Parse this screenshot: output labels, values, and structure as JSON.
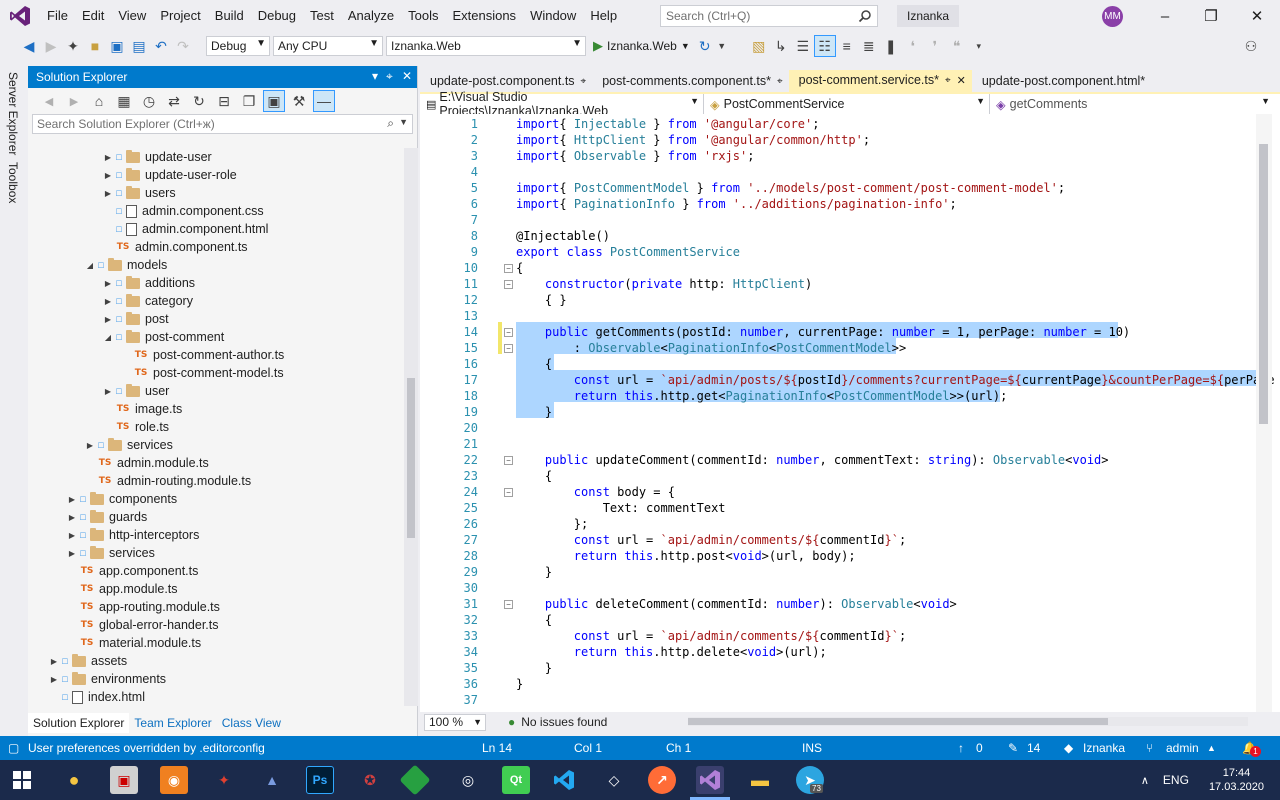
{
  "menu": [
    "File",
    "Edit",
    "View",
    "Project",
    "Build",
    "Debug",
    "Test",
    "Analyze",
    "Tools",
    "Extensions",
    "Window",
    "Help"
  ],
  "search": {
    "placeholder": "Search (Ctrl+Q)"
  },
  "solution_name": "Iznanka",
  "avatar_initials": "MM",
  "toolbar": {
    "config": "Debug",
    "platform": "Any CPU",
    "startup_project": "Iznanka.Web",
    "run_label": "Iznanka.Web"
  },
  "rail": {
    "server_explorer": "Server Explorer",
    "toolbox": "Toolbox"
  },
  "solution_explorer": {
    "title": "Solution Explorer",
    "search_placeholder": "Search Solution Explorer (Ctrl+ж)",
    "tree": [
      {
        "label": "update-user",
        "kind": "folder",
        "depth": 6,
        "expander": "collapsed"
      },
      {
        "label": "update-user-role",
        "kind": "folder",
        "depth": 6,
        "expander": "collapsed"
      },
      {
        "label": "users",
        "kind": "folder",
        "depth": 6,
        "expander": "collapsed"
      },
      {
        "label": "admin.component.css",
        "kind": "file",
        "depth": 6,
        "expander": "none"
      },
      {
        "label": "admin.component.html",
        "kind": "file",
        "depth": 6,
        "expander": "none"
      },
      {
        "label": "admin.component.ts",
        "kind": "ts",
        "depth": 6,
        "expander": "none"
      },
      {
        "label": "models",
        "kind": "folder",
        "depth": 5,
        "expander": "expanded"
      },
      {
        "label": "additions",
        "kind": "folder",
        "depth": 6,
        "expander": "collapsed"
      },
      {
        "label": "category",
        "kind": "folder",
        "depth": 6,
        "expander": "collapsed"
      },
      {
        "label": "post",
        "kind": "folder",
        "depth": 6,
        "expander": "collapsed"
      },
      {
        "label": "post-comment",
        "kind": "folder",
        "depth": 6,
        "expander": "expanded"
      },
      {
        "label": "post-comment-author.ts",
        "kind": "ts",
        "depth": 7,
        "expander": "none"
      },
      {
        "label": "post-comment-model.ts",
        "kind": "ts",
        "depth": 7,
        "expander": "none"
      },
      {
        "label": "user",
        "kind": "folder",
        "depth": 6,
        "expander": "collapsed"
      },
      {
        "label": "image.ts",
        "kind": "ts",
        "depth": 6,
        "expander": "none"
      },
      {
        "label": "role.ts",
        "kind": "ts",
        "depth": 6,
        "expander": "none"
      },
      {
        "label": "services",
        "kind": "folder",
        "depth": 5,
        "expander": "collapsed"
      },
      {
        "label": "admin.module.ts",
        "kind": "ts",
        "depth": 5,
        "expander": "none"
      },
      {
        "label": "admin-routing.module.ts",
        "kind": "ts",
        "depth": 5,
        "expander": "none"
      },
      {
        "label": "components",
        "kind": "folder",
        "depth": 4,
        "expander": "collapsed"
      },
      {
        "label": "guards",
        "kind": "folder",
        "depth": 4,
        "expander": "collapsed"
      },
      {
        "label": "http-interceptors",
        "kind": "folder",
        "depth": 4,
        "expander": "collapsed"
      },
      {
        "label": "services",
        "kind": "folder",
        "depth": 4,
        "expander": "collapsed"
      },
      {
        "label": "app.component.ts",
        "kind": "ts",
        "depth": 4,
        "expander": "none"
      },
      {
        "label": "app.module.ts",
        "kind": "ts",
        "depth": 4,
        "expander": "none"
      },
      {
        "label": "app-routing.module.ts",
        "kind": "ts",
        "depth": 4,
        "expander": "none"
      },
      {
        "label": "global-error-hander.ts",
        "kind": "ts",
        "depth": 4,
        "expander": "none"
      },
      {
        "label": "material.module.ts",
        "kind": "ts",
        "depth": 4,
        "expander": "none"
      },
      {
        "label": "assets",
        "kind": "folder",
        "depth": 3,
        "expander": "collapsed"
      },
      {
        "label": "environments",
        "kind": "folder",
        "depth": 3,
        "expander": "collapsed"
      },
      {
        "label": "index.html",
        "kind": "file",
        "depth": 3,
        "expander": "none"
      }
    ],
    "bottom_tabs": [
      "Solution Explorer",
      "Team Explorer",
      "Class View"
    ]
  },
  "editor": {
    "tabs": [
      {
        "label": "update-post.component.ts",
        "active": false
      },
      {
        "label": "post-comments.component.ts*",
        "active": false
      },
      {
        "label": "post-comment.service.ts*",
        "active": true
      },
      {
        "label": "update-post.component.html*",
        "active": false
      }
    ],
    "nav": {
      "path": "E:\\Visual Studio Projects\\Iznanka\\Iznanka.Web",
      "class": "PostCommentService",
      "member": "getComments"
    },
    "zoom": "100 %",
    "issues": "No issues found",
    "lines": [
      [
        [
          "kw",
          "import"
        ],
        [
          "",
          "{ "
        ],
        [
          "ty",
          "Injectable"
        ],
        [
          "",
          " } "
        ],
        [
          "kw",
          "from"
        ],
        [
          "",
          ""
        ],
        [
          "str",
          " '@angular/core'"
        ],
        [
          "",
          ";"
        ]
      ],
      [
        [
          "kw",
          "import"
        ],
        [
          "",
          "{ "
        ],
        [
          "ty",
          "HttpClient"
        ],
        [
          "",
          " } "
        ],
        [
          "kw",
          "from"
        ],
        [
          "str",
          " '@angular/common/http'"
        ],
        [
          "",
          ";"
        ]
      ],
      [
        [
          "kw",
          "import"
        ],
        [
          "",
          "{ "
        ],
        [
          "ty",
          "Observable"
        ],
        [
          "",
          " } "
        ],
        [
          "kw",
          "from"
        ],
        [
          "str",
          " 'rxjs'"
        ],
        [
          "",
          ";"
        ]
      ],
      [],
      [
        [
          "kw",
          "import"
        ],
        [
          "",
          "{ "
        ],
        [
          "ty",
          "PostCommentModel"
        ],
        [
          "",
          " } "
        ],
        [
          "kw",
          "from"
        ],
        [
          "str",
          " '../models/post-comment/post-comment-model'"
        ],
        [
          "",
          ";"
        ]
      ],
      [
        [
          "kw",
          "import"
        ],
        [
          "",
          "{ "
        ],
        [
          "ty",
          "PaginationInfo"
        ],
        [
          "",
          " } "
        ],
        [
          "kw",
          "from"
        ],
        [
          "str",
          " '../additions/pagination-info'"
        ],
        [
          "",
          ";"
        ]
      ],
      [],
      [
        [
          "",
          "@Injectable()"
        ]
      ],
      [
        [
          "kw",
          "export class "
        ],
        [
          "ty",
          "PostCommentService"
        ]
      ],
      [
        [
          "",
          "{"
        ]
      ],
      [
        [
          "",
          "    "
        ],
        [
          "kw",
          "constructor"
        ],
        [
          "",
          "("
        ],
        [
          "kw",
          "private"
        ],
        [
          "",
          " http: "
        ],
        [
          "ty",
          "HttpClient"
        ],
        [
          "",
          ")"
        ]
      ],
      [
        [
          "",
          "    { }"
        ]
      ],
      [],
      [
        [
          "",
          "    "
        ],
        [
          "kw",
          "public"
        ],
        [
          "",
          " getComments(postId: "
        ],
        [
          "kw",
          "number"
        ],
        [
          "",
          ", currentPage: "
        ],
        [
          "kw",
          "number"
        ],
        [
          "",
          " = 1, perPage: "
        ],
        [
          "kw",
          "number"
        ],
        [
          "",
          " = 10)"
        ]
      ],
      [
        [
          "",
          "        : "
        ],
        [
          "ty",
          "Observable"
        ],
        [
          "",
          "<"
        ],
        [
          "ty",
          "PaginationInfo"
        ],
        [
          "",
          "<"
        ],
        [
          "ty",
          "PostCommentModel"
        ],
        [
          "",
          ">>"
        ]
      ],
      [
        [
          "",
          "    {"
        ]
      ],
      [
        [
          "",
          "        "
        ],
        [
          "kw",
          "const"
        ],
        [
          "",
          " url = "
        ],
        [
          "str",
          "`api/admin/posts/${"
        ],
        [
          "",
          "postId"
        ],
        [
          "str",
          "}/comments?currentPage=${"
        ],
        [
          "",
          "currentPage"
        ],
        [
          "str",
          "}&countPerPage=${"
        ],
        [
          "",
          "perPage"
        ]
      ],
      [
        [
          "",
          "        "
        ],
        [
          "kw",
          "return this"
        ],
        [
          "",
          ".http.get<"
        ],
        [
          "ty",
          "PaginationInfo"
        ],
        [
          "",
          "<"
        ],
        [
          "ty",
          "PostCommentModel"
        ],
        [
          "",
          ">>(url);"
        ]
      ],
      [
        [
          "",
          "    }"
        ]
      ],
      [],
      [],
      [
        [
          "",
          "    "
        ],
        [
          "kw",
          "public"
        ],
        [
          "",
          " updateComment(commentId: "
        ],
        [
          "kw",
          "number"
        ],
        [
          "",
          ", commentText: "
        ],
        [
          "kw",
          "string"
        ],
        [
          "",
          "): "
        ],
        [
          "ty",
          "Observable"
        ],
        [
          "",
          "<"
        ],
        [
          "kw",
          "void"
        ],
        [
          "",
          ">"
        ]
      ],
      [
        [
          "",
          "    {"
        ]
      ],
      [
        [
          "",
          "        "
        ],
        [
          "kw",
          "const"
        ],
        [
          "",
          " body = {"
        ]
      ],
      [
        [
          "",
          "            Text: commentText"
        ]
      ],
      [
        [
          "",
          "        };"
        ]
      ],
      [
        [
          "",
          "        "
        ],
        [
          "kw",
          "const"
        ],
        [
          "",
          " url = "
        ],
        [
          "str",
          "`api/admin/comments/${"
        ],
        [
          "",
          "commentId"
        ],
        [
          "str",
          "}`"
        ],
        [
          "",
          ";"
        ]
      ],
      [
        [
          "",
          "        "
        ],
        [
          "kw",
          "return this"
        ],
        [
          "",
          ".http.post<"
        ],
        [
          "kw",
          "void"
        ],
        [
          "",
          ">(url, body);"
        ]
      ],
      [
        [
          "",
          "    }"
        ]
      ],
      [],
      [
        [
          "",
          "    "
        ],
        [
          "kw",
          "public"
        ],
        [
          "",
          " deleteComment(commentId: "
        ],
        [
          "kw",
          "number"
        ],
        [
          "",
          "): "
        ],
        [
          "ty",
          "Observable"
        ],
        [
          "",
          "<"
        ],
        [
          "kw",
          "void"
        ],
        [
          "",
          ">"
        ]
      ],
      [
        [
          "",
          "    {"
        ]
      ],
      [
        [
          "",
          "        "
        ],
        [
          "kw",
          "const"
        ],
        [
          "",
          " url = "
        ],
        [
          "str",
          "`api/admin/comments/${"
        ],
        [
          "",
          "commentId"
        ],
        [
          "str",
          "}`"
        ],
        [
          "",
          ";"
        ]
      ],
      [
        [
          "",
          "        "
        ],
        [
          "kw",
          "return this"
        ],
        [
          "",
          ".http.delete<"
        ],
        [
          "kw",
          "void"
        ],
        [
          "",
          ">(url);"
        ]
      ],
      [
        [
          "",
          "    }"
        ]
      ],
      [
        [
          "",
          "}"
        ]
      ],
      []
    ]
  },
  "status": {
    "message": "User preferences overridden by .editorconfig",
    "ln": "Ln 14",
    "col": "Col 1",
    "ch": "Ch 1",
    "mode": "INS",
    "up_count": "0",
    "edit_count": "14",
    "repo": "Iznanka",
    "branch": "admin"
  },
  "taskbar": {
    "lang": "ENG",
    "time": "17:44",
    "date": "17.03.2020",
    "telegram_badge": "73",
    "notif_badge": "1"
  }
}
